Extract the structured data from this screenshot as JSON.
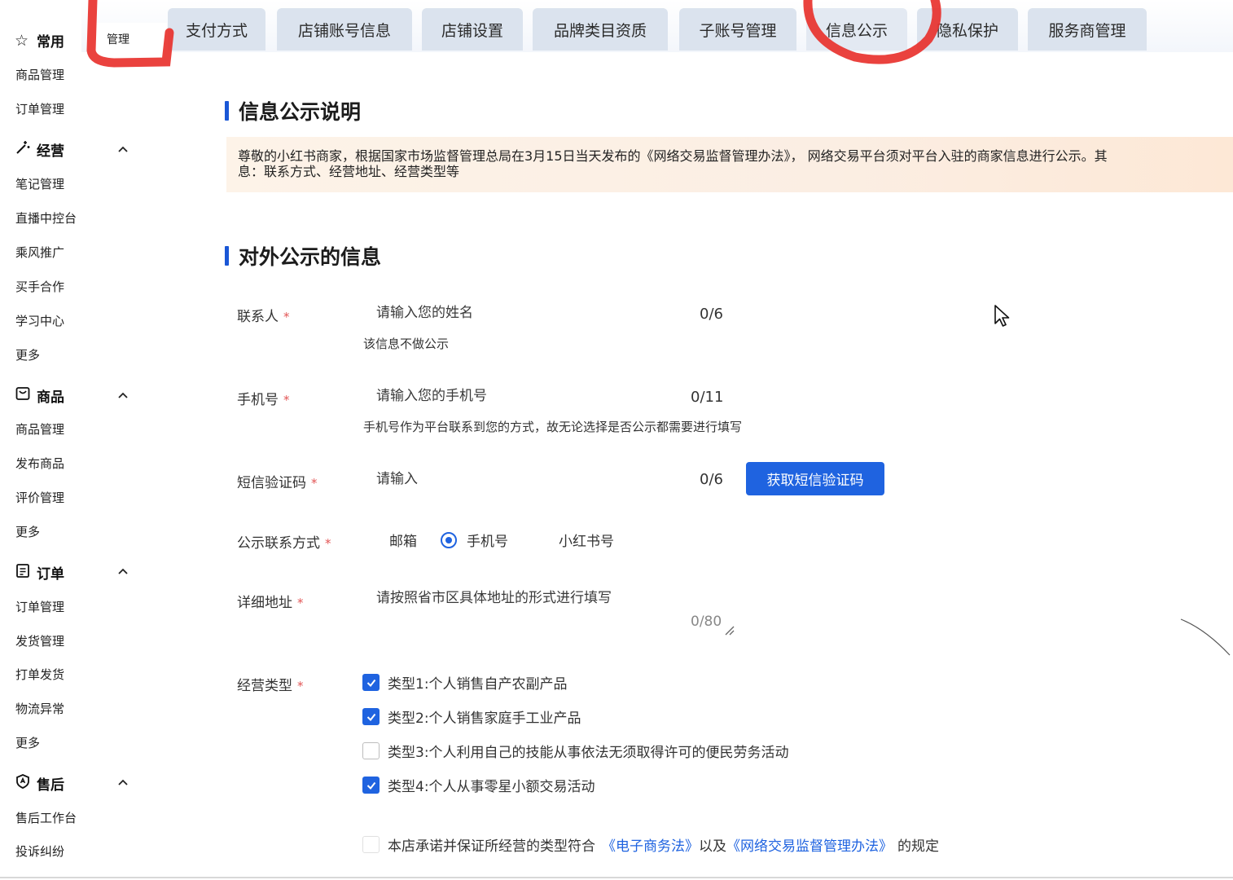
{
  "sidebar": {
    "groups": [
      {
        "key": "common",
        "label": "常用",
        "icon": "star-icon",
        "items": [
          "商品管理",
          "订单管理"
        ]
      },
      {
        "key": "operation",
        "label": "经营",
        "icon": "magic-wand-icon",
        "items": [
          "笔记管理",
          "直播中控台",
          "乘风推广",
          "买手合作",
          "学习中心",
          "更多"
        ]
      },
      {
        "key": "goods",
        "label": "商品",
        "icon": "bag-icon",
        "items": [
          "商品管理",
          "发布商品",
          "评价管理",
          "更多"
        ]
      },
      {
        "key": "order",
        "label": "订单",
        "icon": "clipboard-icon",
        "items": [
          "订单管理",
          "发货管理",
          "打单发货",
          "物流异常",
          "更多"
        ]
      },
      {
        "key": "aftersale",
        "label": "售后",
        "icon": "shield-icon",
        "items": [
          "售后工作台",
          "投诉纠纷"
        ]
      }
    ]
  },
  "tabs": {
    "first": "管理",
    "items": [
      "支付方式",
      "店铺账号信息",
      "店铺设置",
      "品牌类目资质",
      "子账号管理",
      "信息公示",
      "隐私保护",
      "服务商管理"
    ],
    "active": "信息公示"
  },
  "section1": {
    "title": "信息公示说明",
    "notice_line1": "尊敬的小红书商家，根据国家市场监督管理总局在3月15日当天发布的《网络交易监督管理办法》， 网络交易平台须对平台入驻的商家信息进行公示。其",
    "notice_line2": "息：联系方式、经营地址、经营类型等"
  },
  "section2": {
    "title": "对外公示的信息",
    "required_mark": "*",
    "contact": {
      "label": "联系人",
      "placeholder": "请输入您的姓名",
      "count": "0/6",
      "hint": "该信息不做公示"
    },
    "phone": {
      "label": "手机号",
      "placeholder": "请输入您的手机号",
      "count": "0/11",
      "hint": "手机号作为平台联系到您的方式，故无论选择是否公示都需要进行填写"
    },
    "sms": {
      "label": "短信验证码",
      "placeholder": "请输入",
      "count": "0/6",
      "button": "获取短信验证码"
    },
    "public_contact": {
      "label": "公示联系方式",
      "options": [
        "邮箱",
        "手机号",
        "小红书号"
      ],
      "selected": "手机号"
    },
    "address": {
      "label": "详细地址",
      "placeholder": "请按照省市区具体地址的形式进行填写",
      "count": "0/80"
    },
    "business_type": {
      "label": "经营类型",
      "options": [
        {
          "label": "类型1:个人销售自产农副产品",
          "checked": true
        },
        {
          "label": "类型2:个人销售家庭手工业产品",
          "checked": true
        },
        {
          "label": "类型3:个人利用自己的技能从事依法无须取得许可的便民劳务活动",
          "checked": false
        },
        {
          "label": "类型4:个人从事零星小额交易活动",
          "checked": true
        }
      ]
    },
    "agreement": {
      "prefix": "本店承诺并保证所经营的类型符合",
      "link1": "《电子商务法》",
      "middle": "以及",
      "link2": "《网络交易监督管理办法》",
      "suffix": "的规定",
      "checked": false
    }
  },
  "colors": {
    "accent": "#1f63e0",
    "tab_bg": "#dbe3ee",
    "notice_bg": "#fdf3e8",
    "required": "#e25555",
    "annotation": "#e8322e"
  }
}
